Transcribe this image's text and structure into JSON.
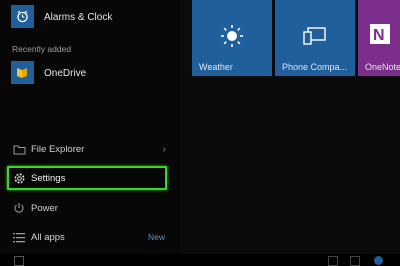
{
  "start_menu": {
    "apps": [
      {
        "label": "Alarms & Clock",
        "icon": "alarm-clock-icon"
      },
      {
        "label": "OneDrive",
        "icon": "onedrive-icon"
      }
    ],
    "recently_added_label": "Recently added",
    "nav": {
      "file_explorer": "File Explorer",
      "settings": "Settings",
      "power": "Power",
      "all_apps": "All apps",
      "new_badge": "New"
    }
  },
  "tiles": [
    {
      "label": "Weather",
      "icon": "sun-icon",
      "color": "#1f5f9b"
    },
    {
      "label": "Phone Compa...",
      "icon": "phone-companion-icon",
      "color": "#1f5f9b"
    },
    {
      "label": "OneNote",
      "icon": "onenote-icon",
      "color": "#7b2f8a"
    }
  ],
  "colors": {
    "highlight": "#39d62e",
    "tile_blue": "#1f5f9b",
    "tile_purple": "#7b2f8a"
  }
}
